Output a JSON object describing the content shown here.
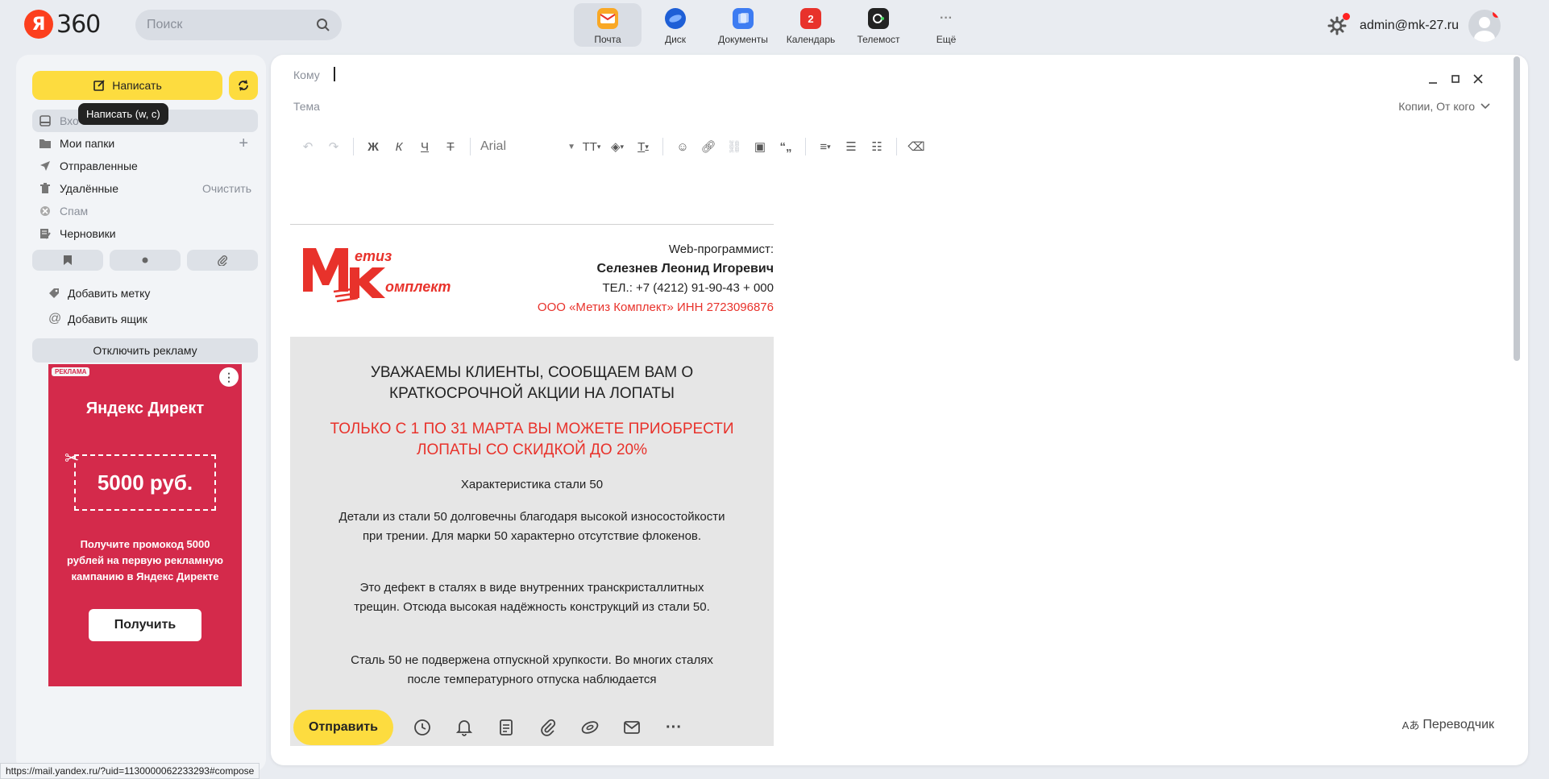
{
  "topbar": {
    "logo_letter": "Я",
    "logo_text": "360",
    "search_placeholder": "Поиск",
    "services": [
      {
        "label": "Почта",
        "icon": "mail-icon",
        "color": "#f9a825",
        "active": true
      },
      {
        "label": "Диск",
        "icon": "disk-icon",
        "color": "#1e5fd6",
        "active": false
      },
      {
        "label": "Документы",
        "icon": "documents-icon",
        "color": "#3d7cf2",
        "active": false
      },
      {
        "label": "Календарь",
        "icon": "calendar-icon",
        "color": "#e8322b",
        "badge": "2",
        "active": false
      },
      {
        "label": "Телемост",
        "icon": "telemost-icon",
        "color": "#222222",
        "active": false
      },
      {
        "label": "Ещё",
        "icon": "more-icon",
        "color": "#888888",
        "active": false
      }
    ],
    "user_email": "admin@mk-27.ru"
  },
  "sidebar": {
    "compose_label": "Написать",
    "tooltip": "Написать (w, c)",
    "folders": [
      {
        "label": "Входящие",
        "visible_label": "Вхо",
        "icon": "inbox-icon",
        "active": true
      },
      {
        "label": "Мои папки",
        "icon": "folder-icon",
        "action": "+"
      },
      {
        "label": "Отправленные",
        "icon": "sent-icon"
      },
      {
        "label": "Удалённые",
        "icon": "trash-icon",
        "action": "Очистить"
      },
      {
        "label": "Спам",
        "icon": "spam-icon",
        "dim": true
      },
      {
        "label": "Черновики",
        "icon": "drafts-icon"
      }
    ],
    "add_label": "Добавить метку",
    "add_mailbox": "Добавить ящик",
    "disable_ads": "Отключить рекламу"
  },
  "ad": {
    "tag": "РЕКЛАМА",
    "brand": "Яндекс Директ",
    "coupon": "5000 руб.",
    "text": "Получите промокод 5000 рублей на первую рекламную кампанию в Яндекс Директе",
    "button": "Получить",
    "color": "#d42a4b"
  },
  "status_url": "https://mail.yandex.ru/?uid=1130000062233293#compose",
  "compose": {
    "to_label": "Кому",
    "subject_label": "Тема",
    "copies_label": "Копии, От кого",
    "font": "Arial",
    "signature": {
      "role": "Web-программист:",
      "name": "Селезнев Леонид Игоревич",
      "phone": "ТЕЛ.: +7 (4212) 91-90-43 + 000",
      "company": "ООО «Метиз Комплект» ИНН 2723096876",
      "logo_top": "етиз",
      "logo_bottom": "омплект"
    },
    "promo": {
      "heading": "УВАЖАЕМЫ КЛИЕНТЫ, СООБЩАЕМ ВАМ О КРАТКОСРОЧНОЙ АКЦИИ НА ЛОПАТЫ",
      "highlight": "ТОЛЬКО С 1 ПО 31 МАРТА ВЫ МОЖЕТЕ ПРИОБРЕСТИ ЛОПАТЫ СО СКИДКОЙ ДО 20%",
      "p1": "Характеристика стали 50",
      "p2": "Детали из стали 50 долговечны благодаря высокой износостойкости при трении. Для марки 50 характерно отсутствие флокенов.",
      "p3": "Это дефект в сталях в виде внутренних транскристаллитных трещин. Отсюда высокая надёжность конструкций из стали 50.",
      "p4": "Сталь 50 не подвержена отпускной хрупкости. Во многих сталях после температурного отпуска наблюдается"
    },
    "send_label": "Отправить",
    "translator_label": "Переводчик"
  }
}
